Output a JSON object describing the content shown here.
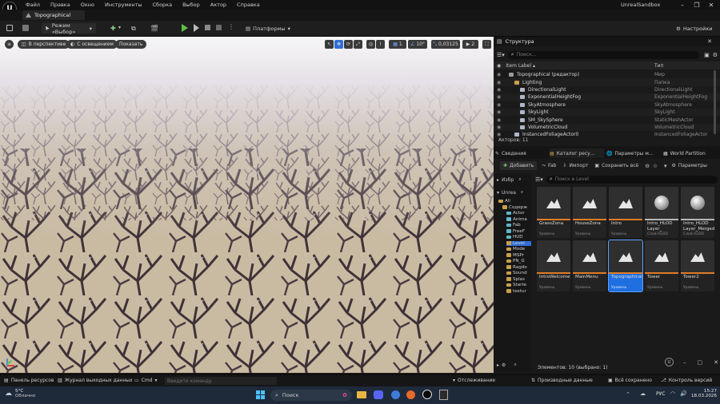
{
  "menu": {
    "items": [
      "Файл",
      "Правка",
      "Окно",
      "Инструменты",
      "Сборка",
      "Выбор",
      "Актор",
      "Справка"
    ],
    "app_title": "UnrealSandbox"
  },
  "tab": {
    "label": "Topographical"
  },
  "toolbar": {
    "mode_label": "Режим «Выбор»",
    "platforms_label": "Платформы",
    "settings_label": "Настройки"
  },
  "viewport": {
    "perspective_label": "В перспективе",
    "lit_label": "С освещением",
    "show_label": "Показать",
    "grid_value": "10°",
    "scale_value": "0,03125",
    "camera_value": "2",
    "snap_value": "1"
  },
  "outliner": {
    "title": "Структура",
    "search_placeholder": "Поиск…",
    "col_label": "Item Label",
    "col_type": "Тип",
    "rows": [
      {
        "label": "Topographical (редактор)",
        "type": "Мир",
        "indent": 1
      },
      {
        "label": "Lighting",
        "type": "Папка",
        "indent": 2
      },
      {
        "label": "DirectionalLight",
        "type": "DirectionalLight",
        "indent": 3
      },
      {
        "label": "ExponentialHeightFog",
        "type": "ExponentialHeightFog",
        "indent": 3
      },
      {
        "label": "SkyAtmosphere",
        "type": "SkyAtmosphere",
        "indent": 3
      },
      {
        "label": "SkyLight",
        "type": "SkyLight",
        "indent": 3
      },
      {
        "label": "SM_SkySphere",
        "type": "StaticMeshActor",
        "indent": 3
      },
      {
        "label": "VolumetricCloud",
        "type": "VolumetricCloud",
        "indent": 3
      },
      {
        "label": "InstancedFoliageActor0",
        "type": "InstancedFoliageActor",
        "indent": 2
      }
    ],
    "actors_count": "Акторов: 11"
  },
  "panel_tabs": [
    "Сведения",
    "Каталог ресу…",
    "Параметры м…",
    "World Partition"
  ],
  "content_browser": {
    "add_label": "Добавить",
    "fab_label": "Fab",
    "import_label": "Импорт",
    "save_all_label": "Сохранить всё",
    "params_label": "Параметры",
    "favorites_label": "Избр",
    "project_label": "Unrea",
    "search_placeholder": "Поиск в Level",
    "tree": [
      "All",
      "Содерж",
      "Actor",
      "Anima",
      "Fab",
      "FreeF",
      "HUD",
      "Level",
      "Mode",
      "MSPr",
      "PN_G",
      "Ragdo",
      "Sound",
      "Splas",
      "Starte",
      "textur"
    ],
    "assets": [
      {
        "name": "GrassZona",
        "type": "Уровень"
      },
      {
        "name": "HouseZona",
        "type": "Уровень"
      },
      {
        "name": "Intro",
        "type": "Уровень"
      },
      {
        "name": "Intro_HLOD Layer_",
        "type": "Слой HLOD"
      },
      {
        "name": "Intro_HLOD Layer_Merged",
        "type": "Слой HLOD"
      },
      {
        "name": "IntroWelcome",
        "type": "Уровень"
      },
      {
        "name": "MainMenu",
        "type": "Уровень"
      },
      {
        "name": "Topographical",
        "type": "Уровень"
      },
      {
        "name": "Tower",
        "type": "Уровень"
      },
      {
        "name": "Tower2",
        "type": "Уровень"
      }
    ],
    "status": "Элементов: 10 (выбрано: 1)"
  },
  "statusbar": {
    "content_drawer": "Панель ресурсов",
    "output_log": "Журнал выходных данных",
    "cmd_label": "Cmd",
    "cmd_placeholder": "Введите команду",
    "tracking": "Отслеживание",
    "derived_data": "Производные данные",
    "all_saved": "Всё сохранено",
    "source_control": "Контроль версий"
  },
  "taskbar": {
    "weather_temp": "5°C",
    "weather_desc": "Облачно",
    "search_placeholder": "Поиск",
    "lang": "РУС",
    "time": "15:27",
    "date": "18.03.2026"
  }
}
